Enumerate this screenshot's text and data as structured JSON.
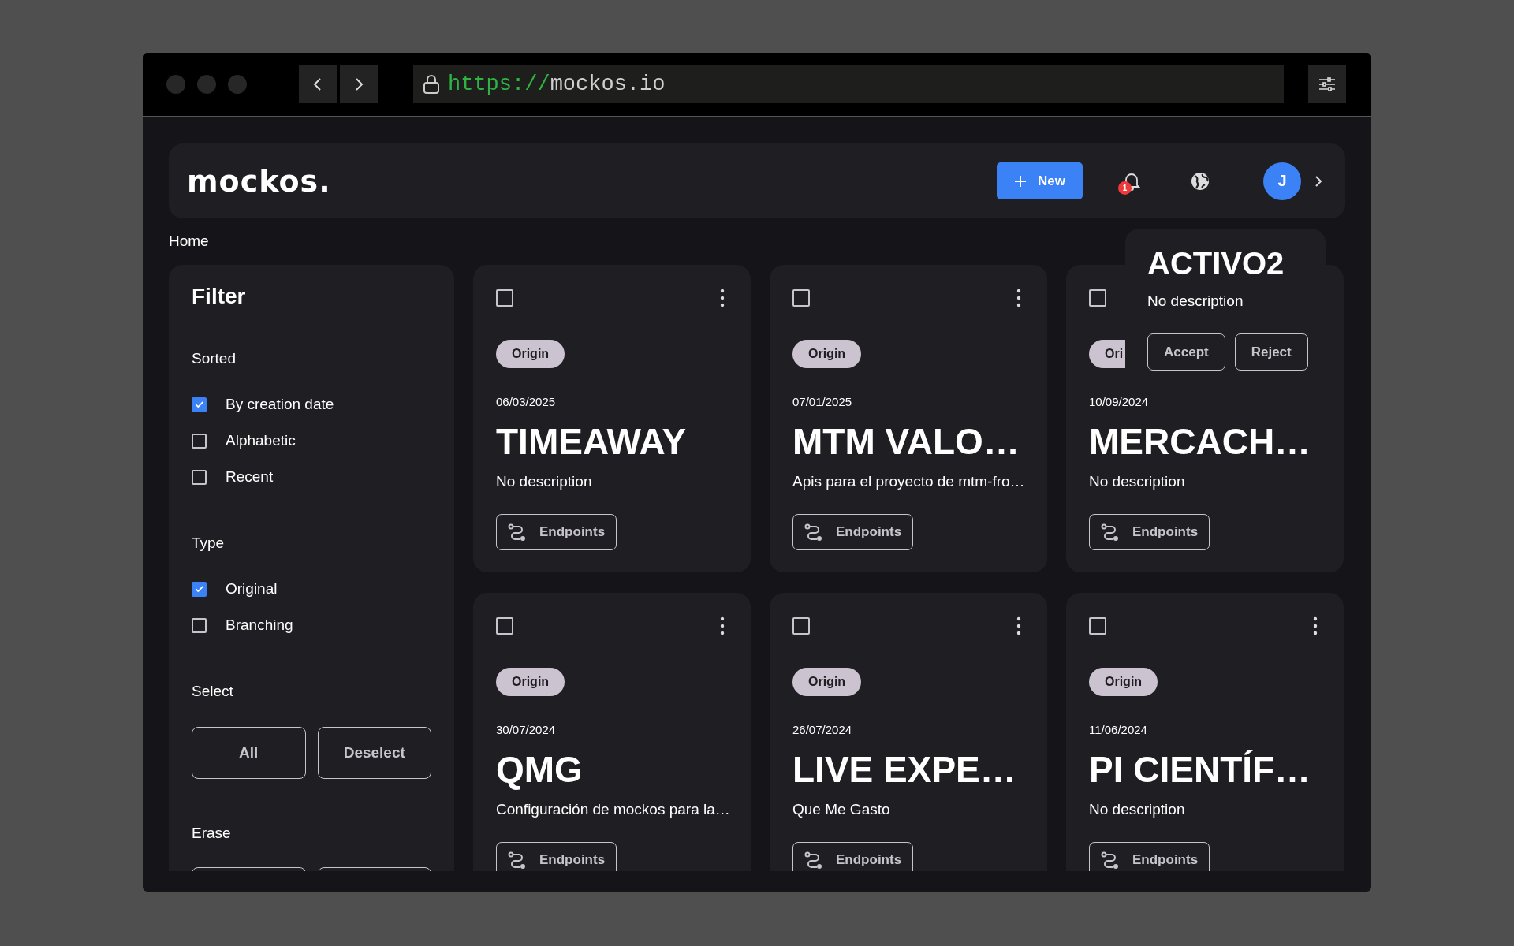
{
  "browser": {
    "url_scheme": "https://",
    "url_host": "mockos.io"
  },
  "header": {
    "logo": "mockos.",
    "new_button": "New",
    "notification_count": "1",
    "avatar_initial": "J"
  },
  "breadcrumb": "Home",
  "filter": {
    "title": "Filter",
    "sections": [
      {
        "title": "Sorted",
        "options": [
          {
            "label": "By creation date",
            "checked": true
          },
          {
            "label": "Alphabetic",
            "checked": false
          },
          {
            "label": "Recent",
            "checked": false
          }
        ]
      },
      {
        "title": "Type",
        "options": [
          {
            "label": "Original",
            "checked": true
          },
          {
            "label": "Branching",
            "checked": false
          }
        ]
      }
    ],
    "select": {
      "title": "Select",
      "buttons": [
        "All",
        "Deselect"
      ]
    },
    "erase": {
      "title": "Erase"
    }
  },
  "cards": [
    {
      "checked": false,
      "menu": true,
      "tag": "Origin",
      "date": "06/03/2025",
      "title": "TIMEAWAY",
      "description": "No description",
      "action": "Endpoints"
    },
    {
      "checked": false,
      "menu": true,
      "tag": "Origin",
      "date": "07/01/2025",
      "title": "MTM VALO…",
      "description": "Apis para el proyecto de mtm-fro…",
      "action": "Endpoints"
    },
    {
      "checked": false,
      "menu": false,
      "tag": "Ori",
      "date": "10/09/2024",
      "title": "MERCACH…",
      "description": "No description",
      "action": "Endpoints"
    },
    {
      "checked": false,
      "menu": true,
      "tag": "Origin",
      "date": "30/07/2024",
      "title": "QMG",
      "description": "Configuración de mockos para la…",
      "action": "Endpoints"
    },
    {
      "checked": false,
      "menu": true,
      "tag": "Origin",
      "date": "26/07/2024",
      "title": "LIVE EXPE…",
      "description": "Que Me Gasto",
      "action": "Endpoints"
    },
    {
      "checked": false,
      "menu": true,
      "tag": "Origin",
      "date": "11/06/2024",
      "title": "PI CIENTÍF…",
      "description": "No description",
      "action": "Endpoints"
    }
  ],
  "popup": {
    "title": "ACTIVO2",
    "description": "No description",
    "buttons": [
      "Accept",
      "Reject"
    ]
  }
}
